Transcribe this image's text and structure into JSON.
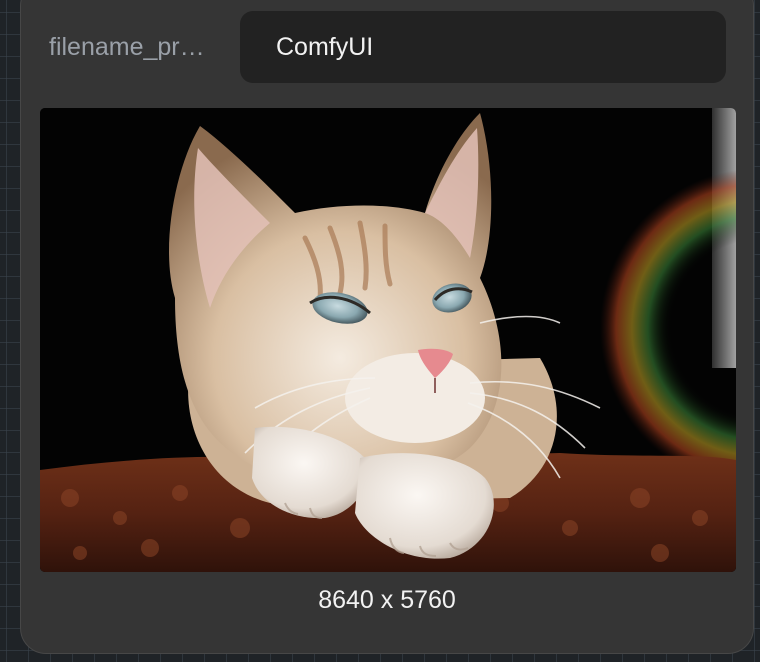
{
  "widget": {
    "label": "filename_pr…",
    "value": "ComfyUI"
  },
  "preview": {
    "subject": "tabby-kitten-photo"
  },
  "image_info": {
    "dimensions": "8640 x 5760"
  }
}
